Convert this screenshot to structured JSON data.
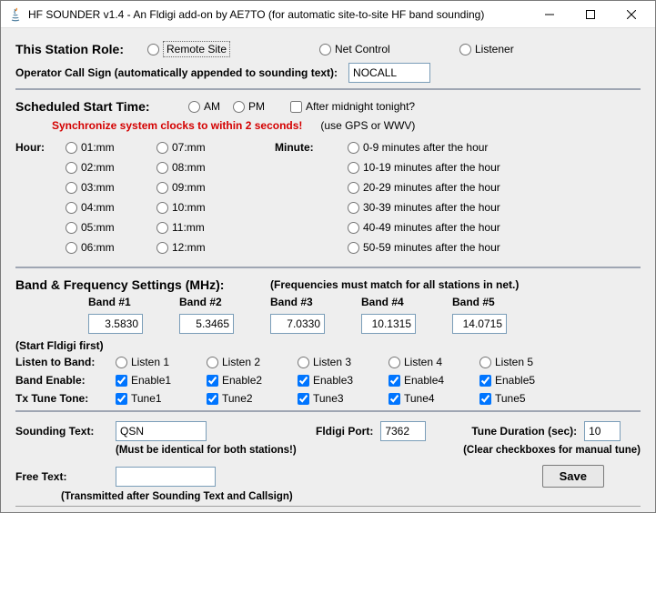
{
  "window": {
    "title": "HF SOUNDER v1.4 - An Fldigi add-on by AE7TO (for automatic site-to-site HF band sounding)"
  },
  "role": {
    "label": "This Station Role:",
    "remote": "Remote Site",
    "net": "Net Control",
    "listener": "Listener"
  },
  "callsign": {
    "label": "Operator Call Sign (automatically appended to sounding text):",
    "value": "NOCALL"
  },
  "schedule": {
    "label": "Scheduled Start Time:",
    "am": "AM",
    "pm": "PM",
    "after_midnight": "After midnight tonight?",
    "sync_warn": "Synchronize system clocks to within 2 seconds!",
    "gps_note": "(use GPS or WWV)",
    "hour_label": "Hour:",
    "minute_label": "Minute:",
    "hours_col1": [
      "01:mm",
      "02:mm",
      "03:mm",
      "04:mm",
      "05:mm",
      "06:mm"
    ],
    "hours_col2": [
      "07:mm",
      "08:mm",
      "09:mm",
      "10:mm",
      "11:mm",
      "12:mm"
    ],
    "minutes": [
      "0-9   minutes after the hour",
      "10-19 minutes after the hour",
      "20-29 minutes after the hour",
      "30-39 minutes after the hour",
      "40-49 minutes after the hour",
      "50-59 minutes after the hour"
    ]
  },
  "bands": {
    "heading": "Band & Frequency Settings (MHz):",
    "note": "(Frequencies must match for all stations in net.)",
    "headers": [
      "Band #1",
      "Band #2",
      "Band #3",
      "Band #4",
      "Band #5"
    ],
    "values": [
      "3.5830",
      "5.3465",
      "7.0330",
      "10.1315",
      "14.0715"
    ],
    "start_fldigi": "(Start Fldigi first)",
    "listen_label": "Listen to Band:",
    "listen": [
      "Listen 1",
      "Listen 2",
      "Listen 3",
      "Listen 4",
      "Listen 5"
    ],
    "enable_label": "Band Enable:",
    "enable": [
      "Enable1",
      "Enable2",
      "Enable3",
      "Enable4",
      "Enable5"
    ],
    "tune_label": "Tx Tune Tone:",
    "tune": [
      "Tune1",
      "Tune2",
      "Tune3",
      "Tune4",
      "Tune5"
    ]
  },
  "bottom": {
    "sounding_label": "Sounding Text:",
    "sounding_value": "QSN",
    "sounding_note": "(Must be identical for both stations!)",
    "port_label": "Fldigi Port:",
    "port_value": "7362",
    "duration_label": "Tune Duration (sec):",
    "duration_value": "10",
    "duration_note": "(Clear checkboxes for manual tune)",
    "free_label": "Free Text:",
    "free_value": "",
    "free_note": "(Transmitted after Sounding Text and Callsign)",
    "save": "Save"
  }
}
